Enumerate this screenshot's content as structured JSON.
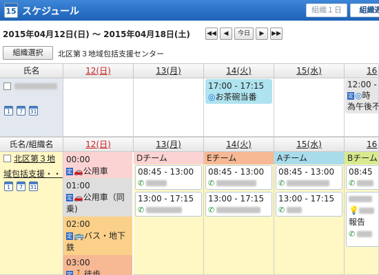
{
  "header": {
    "icon_day": "15",
    "title": "スケジュール",
    "view_buttons": [
      "組織１日",
      "組織週"
    ]
  },
  "date_range": "2015年04月12日(日) ～ 2015年04月18日(土)",
  "nav": {
    "first": "◀◀",
    "prev": "◀",
    "today": "今日",
    "next": "▶",
    "last": "▶▶"
  },
  "org": {
    "button": "組織選択",
    "name": "北区第３地域包括支援センター"
  },
  "mini_cal": {
    "day": "1",
    "week": "7",
    "month": "31"
  },
  "week_top": {
    "name_header": "氏名",
    "days": [
      "12(日)",
      "13(月)",
      "14(火)",
      "15(水)",
      "16"
    ],
    "events": {
      "tue": {
        "time": "17:00 - 17:15",
        "title": "お茶碗当番"
      },
      "thu": {
        "time": "12:00 -",
        "tag": "定",
        "line2": "時",
        "line3": "為午後不"
      }
    }
  },
  "week_bottom": {
    "name_header": "氏名/組織名",
    "days": [
      "12(日)",
      "13(月)",
      "14(火)",
      "15(水)",
      "16"
    ],
    "org_name_line1": "北区第３地",
    "org_name_line2": "域包括支援・・・",
    "sun_slots": [
      {
        "time": "00:00",
        "tag": "定",
        "label": "公用車"
      },
      {
        "time": "01:00",
        "tag": "定",
        "label": "公用車（同乗)"
      },
      {
        "time": "02:00",
        "tag": "定",
        "label": "バス・地下鉄"
      },
      {
        "time": "03:00",
        "tag": "定",
        "label": "徒歩"
      }
    ],
    "teams": [
      {
        "name": "Dチーム",
        "color": "#fbd3d3",
        "slots": [
          "08:45 - 13:00",
          "13:00 - 17:15"
        ]
      },
      {
        "name": "Eチーム",
        "color": "#f7b894",
        "slots": [
          "08:45 - 13:00",
          "13:00 - 17:15"
        ]
      },
      {
        "name": "Aチーム",
        "color": "#a9dcea",
        "slots": [
          "08:45 - 13:00",
          "13:00 - 17:15"
        ]
      },
      {
        "name": "Bチーム",
        "color": "#d8ea8e",
        "slots": [
          "08:45",
          "報告"
        ]
      }
    ]
  },
  "colors": {
    "title_bar": "#1d62b6",
    "sunday": "#c82020",
    "week_bg": "#fff7c4"
  }
}
